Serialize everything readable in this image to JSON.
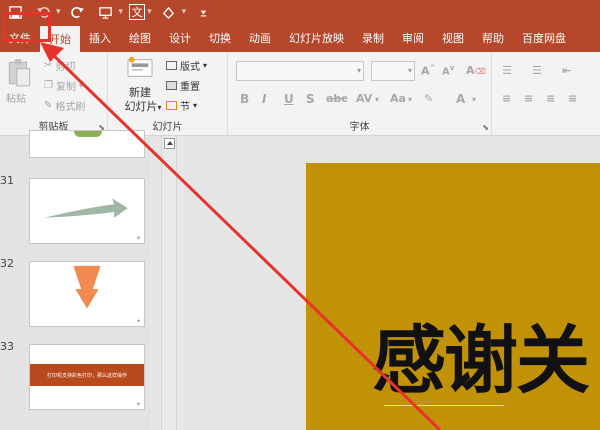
{
  "colors": {
    "accent": "#b7472a",
    "ribbon_bg": "#f3f3f3",
    "slide_bg": "#c29206",
    "annotation": "#e8322c"
  },
  "quick_access": {
    "icons": [
      "save-icon",
      "undo-icon",
      "redo-icon",
      "present-icon",
      "translate-icon",
      "shape-icon",
      "customize-icon"
    ],
    "translate_glyph": "文"
  },
  "tabs": [
    {
      "label": "文件",
      "active": false
    },
    {
      "label": "开始",
      "active": true
    },
    {
      "label": "插入",
      "active": false
    },
    {
      "label": "绘图",
      "active": false
    },
    {
      "label": "设计",
      "active": false
    },
    {
      "label": "切换",
      "active": false
    },
    {
      "label": "动画",
      "active": false
    },
    {
      "label": "幻灯片放映",
      "active": false
    },
    {
      "label": "录制",
      "active": false
    },
    {
      "label": "审阅",
      "active": false
    },
    {
      "label": "视图",
      "active": false
    },
    {
      "label": "帮助",
      "active": false
    },
    {
      "label": "百度网盘",
      "active": false
    }
  ],
  "ribbon": {
    "clipboard": {
      "label": "剪贴板",
      "paste": "粘贴",
      "cut": "剪切",
      "copy": "复制",
      "format_painter": "格式刷"
    },
    "slides": {
      "label": "幻灯片",
      "new_slide_line1": "新建",
      "new_slide_line2": "幻灯片",
      "layout": "版式",
      "reset": "重置",
      "section": "节"
    },
    "font": {
      "label": "字体",
      "bold": "B",
      "italic": "I",
      "underline": "U",
      "strike": "S",
      "spacing": "AV",
      "case": "Aa",
      "color": "A"
    }
  },
  "thumbnails": [
    {
      "number": "31"
    },
    {
      "number": "32"
    },
    {
      "number": "33",
      "banner_text": "打印机支持彩色打印，那么这样操作"
    }
  ],
  "slide": {
    "title": "感谢关"
  }
}
